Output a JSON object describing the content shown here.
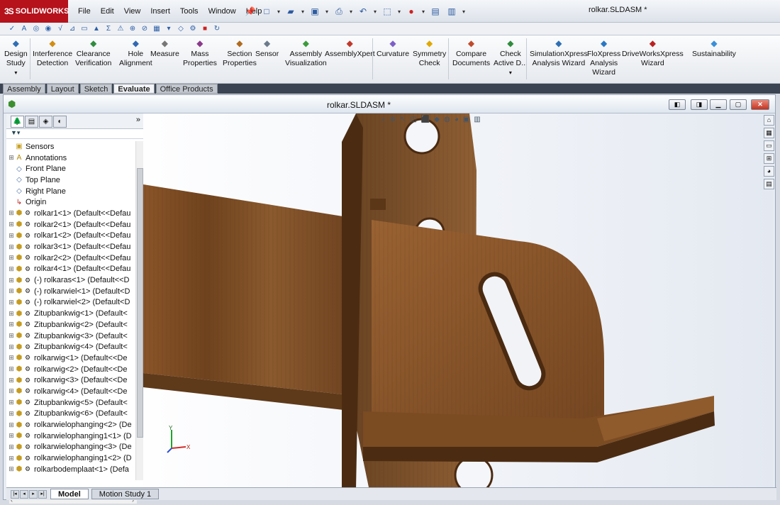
{
  "app": {
    "brand": "SOLIDWORKS",
    "doc_title": "rolkar.SLDASM *"
  },
  "menu": [
    "File",
    "Edit",
    "View",
    "Insert",
    "Tools",
    "Window",
    "Help"
  ],
  "ribbon": [
    {
      "label": "Design\nStudy",
      "icon": "design-study-icon"
    },
    {
      "label": "Interference\nDetection",
      "icon": "interference-icon"
    },
    {
      "label": "Clearance\nVerification",
      "icon": "clearance-icon"
    },
    {
      "label": "Hole\nAlignment",
      "icon": "hole-icon"
    },
    {
      "label": "Measure",
      "icon": "measure-icon"
    },
    {
      "label": "Mass\nProperties",
      "icon": "mass-icon"
    },
    {
      "label": "Section\nProperties",
      "icon": "section-icon"
    },
    {
      "label": "Sensor",
      "icon": "sensor-icon"
    },
    {
      "label": "Assembly\nVisualization",
      "icon": "assembly-vis-icon"
    },
    {
      "label": "AssemblyXpert",
      "icon": "assemblyxpert-icon"
    },
    {
      "label": "Curvature",
      "icon": "curvature-icon"
    },
    {
      "label": "Symmetry\nCheck",
      "icon": "symmetry-icon"
    },
    {
      "label": "Compare\nDocuments",
      "icon": "compare-icon"
    },
    {
      "label": "Check\nActive D...",
      "icon": "check-icon"
    },
    {
      "label": "SimulationXpress\nAnalysis Wizard",
      "icon": "simulation-icon"
    },
    {
      "label": "FloXpress\nAnalysis\nWizard",
      "icon": "floxpress-icon"
    },
    {
      "label": "DriveWorksXpress\nWizard",
      "icon": "driveworks-icon"
    },
    {
      "label": "Sustainability",
      "icon": "sustainability-icon"
    }
  ],
  "tabs": [
    "Assembly",
    "Layout",
    "Sketch",
    "Evaluate",
    "Office Products"
  ],
  "active_tab": "Evaluate",
  "tree": [
    {
      "t": "Sensors",
      "ex": "",
      "i": "folder"
    },
    {
      "t": "Annotations",
      "ex": "+",
      "i": "annot"
    },
    {
      "t": "Front Plane",
      "ex": "",
      "i": "plane"
    },
    {
      "t": "Top Plane",
      "ex": "",
      "i": "plane"
    },
    {
      "t": "Right Plane",
      "ex": "",
      "i": "plane"
    },
    {
      "t": "Origin",
      "ex": "",
      "i": "origin"
    },
    {
      "t": "rolkar1<1> (Default<<Defau",
      "ex": "+",
      "i": "part"
    },
    {
      "t": "rolkar2<1> (Default<<Defau",
      "ex": "+",
      "i": "part"
    },
    {
      "t": "rolkar1<2> (Default<<Defau",
      "ex": "+",
      "i": "part"
    },
    {
      "t": "rolkar3<1> (Default<<Defau",
      "ex": "+",
      "i": "part"
    },
    {
      "t": "rolkar2<2> (Default<<Defau",
      "ex": "+",
      "i": "part"
    },
    {
      "t": "rolkar4<1> (Default<<Defau",
      "ex": "+",
      "i": "part"
    },
    {
      "t": "(-) rolkaras<1> (Default<<D",
      "ex": "+",
      "i": "part"
    },
    {
      "t": "(-) rolkarwiel<1> (Default<D",
      "ex": "+",
      "i": "part"
    },
    {
      "t": "(-) rolkarwiel<2> (Default<D",
      "ex": "+",
      "i": "part"
    },
    {
      "t": "Zitupbankwig<1> (Default<",
      "ex": "+",
      "i": "part"
    },
    {
      "t": "Zitupbankwig<2> (Default<",
      "ex": "+",
      "i": "part"
    },
    {
      "t": "Zitupbankwig<3> (Default<",
      "ex": "+",
      "i": "part"
    },
    {
      "t": "Zitupbankwig<4> (Default<",
      "ex": "+",
      "i": "part"
    },
    {
      "t": "rolkarwig<1> (Default<<De",
      "ex": "+",
      "i": "part"
    },
    {
      "t": "rolkarwig<2> (Default<<De",
      "ex": "+",
      "i": "part"
    },
    {
      "t": "rolkarwig<3> (Default<<De",
      "ex": "+",
      "i": "part"
    },
    {
      "t": "rolkarwig<4> (Default<<De",
      "ex": "+",
      "i": "part"
    },
    {
      "t": "Zitupbankwig<5> (Default<",
      "ex": "+",
      "i": "part"
    },
    {
      "t": "Zitupbankwig<6> (Default<",
      "ex": "+",
      "i": "part"
    },
    {
      "t": "rolkarwielophanging<2> (De",
      "ex": "+",
      "i": "part"
    },
    {
      "t": "rolkarwielophanging1<1> (D",
      "ex": "+",
      "i": "part"
    },
    {
      "t": "rolkarwielophanging<3> (De",
      "ex": "+",
      "i": "part"
    },
    {
      "t": "rolkarwielophanging1<2> (D",
      "ex": "+",
      "i": "part"
    },
    {
      "t": "rolkarbodemplaat<1> (Defa",
      "ex": "+",
      "i": "part"
    }
  ],
  "bottom_tabs": [
    "Model",
    "Motion Study 1"
  ],
  "colors": {
    "brand": "#b5121b",
    "wood": "#7a4a22",
    "wood_dark": "#4e2c10"
  },
  "triad": {
    "y": "Y",
    "x": "X"
  }
}
